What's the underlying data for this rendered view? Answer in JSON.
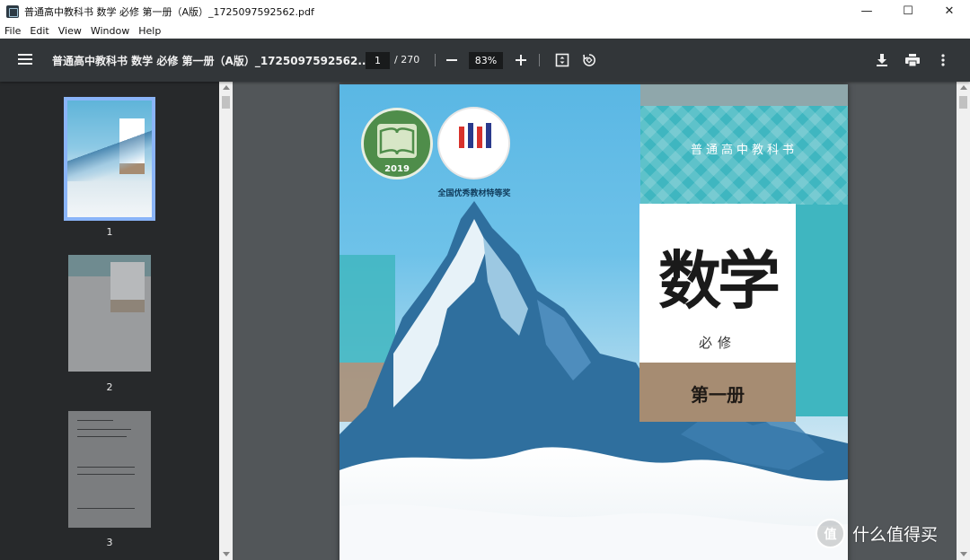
{
  "window": {
    "title": "普通高中教科书 数学 必修 第一册（A版）_1725097592562.pdf",
    "controls": {
      "minimize": "—",
      "maximize": "☐",
      "close": "✕"
    }
  },
  "menu": [
    "File",
    "Edit",
    "View",
    "Window",
    "Help"
  ],
  "toolbar": {
    "doc_title": "普通高中教科书 数学 必修 第一册（A版）_1725097592562....",
    "current_page": "1",
    "total_pages": "/ 270",
    "zoom": "83%",
    "icons": [
      "menu-icon",
      "zoom-out-icon",
      "zoom-in-icon",
      "fit-page-icon",
      "rotate-icon",
      "download-icon",
      "print-icon",
      "more-icon"
    ]
  },
  "sidebar": {
    "thumbnails": [
      {
        "label": "1"
      },
      {
        "label": "2"
      },
      {
        "label": "3"
      }
    ]
  },
  "cover": {
    "series": "普通高中教科书",
    "title": "数学",
    "subtitle": "必修",
    "volume": "第一册",
    "badge_year": "2019",
    "award": "全国优秀教材特等奖"
  },
  "watermark": {
    "logo": "值",
    "text": "什么值得买"
  },
  "colors": {
    "toolbar": "#323639",
    "sidebar": "#27292b",
    "viewer": "#525659",
    "thumb_selected": "#8ab4f8",
    "cover_teal": "#3fb6c0",
    "cover_brown": "#a68c72"
  }
}
